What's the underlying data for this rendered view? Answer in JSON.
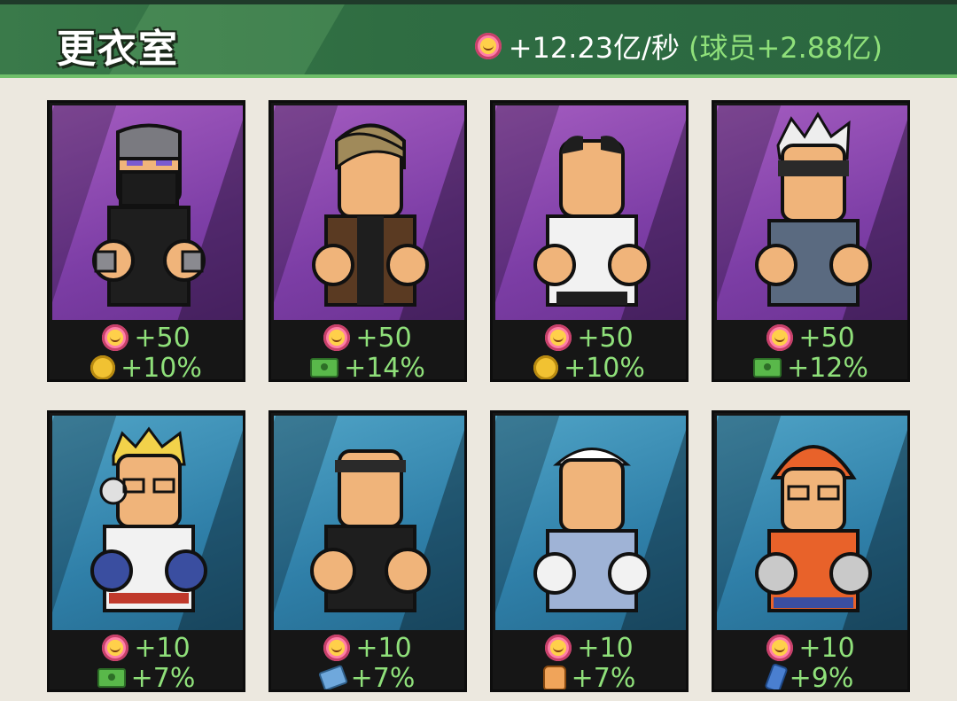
{
  "header": {
    "title": "更衣室",
    "rate_main": "+12.23亿/秒",
    "rate_sub": "(球员+2.88亿)",
    "rate_icon": "flower-coin-icon"
  },
  "colors": {
    "header_green": "#2f6d42",
    "stat_green": "#8fe07a",
    "rare_purple": "#8a46b0",
    "common_blue": "#3a8bb4"
  },
  "cards": [
    {
      "name": "ninja",
      "rarity": "purple",
      "stat1_icon": "flower-coin-icon",
      "stat1": "+50",
      "stat2_icon": "gold-coin-icon",
      "stat2": "+10%"
    },
    {
      "name": "jacket",
      "rarity": "purple",
      "stat1_icon": "flower-coin-icon",
      "stat1": "+50",
      "stat2_icon": "cash-icon",
      "stat2": "+14%"
    },
    {
      "name": "white-shirt",
      "rarity": "purple",
      "stat1_icon": "flower-coin-icon",
      "stat1": "+50",
      "stat2_icon": "gold-coin-icon",
      "stat2": "+10%"
    },
    {
      "name": "blindfold",
      "rarity": "purple",
      "stat1_icon": "flower-coin-icon",
      "stat1": "+50",
      "stat2_icon": "cash-icon",
      "stat2": "+12%"
    },
    {
      "name": "headphones",
      "rarity": "blue",
      "stat1_icon": "flower-coin-icon",
      "stat1": "+10",
      "stat2_icon": "cash-icon",
      "stat2": "+7%"
    },
    {
      "name": "headband",
      "rarity": "blue",
      "stat1_icon": "flower-coin-icon",
      "stat1": "+10",
      "stat2_icon": "id-card-icon",
      "stat2": "+7%"
    },
    {
      "name": "bandana",
      "rarity": "blue",
      "stat1_icon": "flower-coin-icon",
      "stat1": "+10",
      "stat2_icon": "thumbs-up-icon",
      "stat2": "+7%"
    },
    {
      "name": "helmet",
      "rarity": "blue",
      "stat1_icon": "flower-coin-icon",
      "stat1": "+10",
      "stat2_icon": "energy-drink-icon",
      "stat2": "+9%"
    }
  ]
}
